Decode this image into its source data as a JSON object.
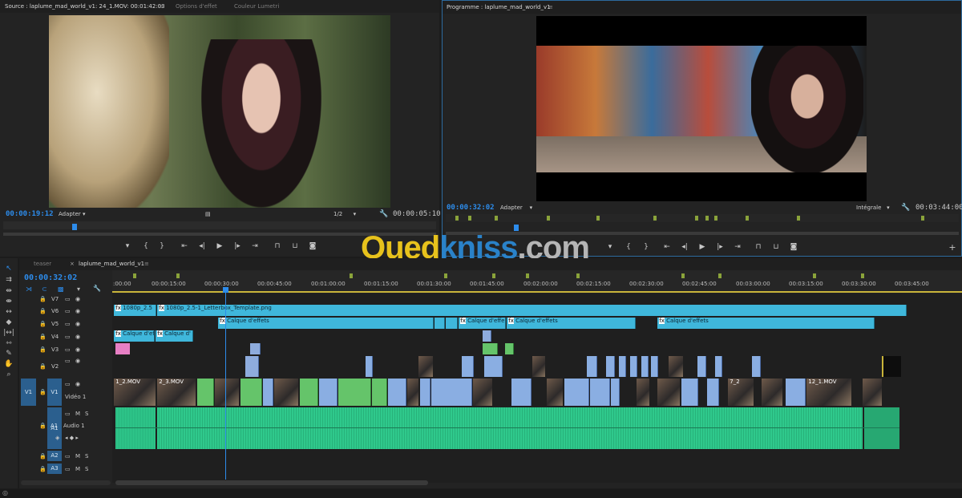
{
  "source": {
    "tabs": [
      "Source : laplume_mad_world_v1: 24_1.MOV: 00:01:42:03",
      "Options d'effet",
      "Couleur Lumetri"
    ],
    "timecode_current": "00:00:19:12",
    "timecode_duration": "00:00:05:10",
    "fit": "Adapter",
    "resolution": "1/2"
  },
  "program": {
    "tab": "Programme : laplume_mad_world_v1",
    "timecode_current": "00:00:32:02",
    "timecode_duration": "00:03:44:00",
    "fit": "Adapter",
    "quality": "Intégrale"
  },
  "watermark": {
    "part1": "Oued",
    "part2": "kniss",
    "part3": ".com"
  },
  "timeline": {
    "tabs": [
      "teaser",
      "laplume_mad_world_v1"
    ],
    "timecode": "00:00:32:02",
    "ruler": [
      ":00:00",
      "00:00:15:00",
      "00:00:30:00",
      "00:00:45:00",
      "00:01:00:00",
      "00:01:15:00",
      "00:01:30:00",
      "00:01:45:00",
      "00:02:00:00",
      "00:02:15:00",
      "00:02:30:00",
      "00:02:45:00",
      "00:03:00:00",
      "00:03:15:00",
      "00:03:30:00",
      "00:03:45:00"
    ],
    "tracks": {
      "v7": "V7",
      "v6": "V6",
      "v5": "V5",
      "v4": "V4",
      "v3": "V3",
      "v2": "V2",
      "v1": "V1",
      "v1_src": "V1",
      "v1_name": "Vidéo 1",
      "a1": "A1",
      "a1_src": "A1",
      "a1_name": "Audio 1",
      "a2": "A2",
      "a3": "A3",
      "m": "M",
      "s": "S"
    },
    "clips": {
      "v6a": "1080p_2.5",
      "v6b": "1080p_2.5-1_Letterbox_Template.png",
      "v5a": "Calque d'effets",
      "v5b": "Calque d'effe",
      "v5c": "Calque d'effets",
      "v5d": "Calque d'effets",
      "v4a": "Calque d'ef",
      "v4b": "Calque d'",
      "v1a": "1_2.MOV",
      "v1b": "2_3.MOV",
      "v1c": "7_2",
      "v1d": "12_1.MOV"
    }
  },
  "colors": {
    "accent": "#2d8ceb",
    "adjustment_clip": "#3fb7db",
    "video_clip": "#8aaee2",
    "green_clip": "#65c46a",
    "audio": "#2fc98c",
    "marker": "#8aa33a"
  }
}
